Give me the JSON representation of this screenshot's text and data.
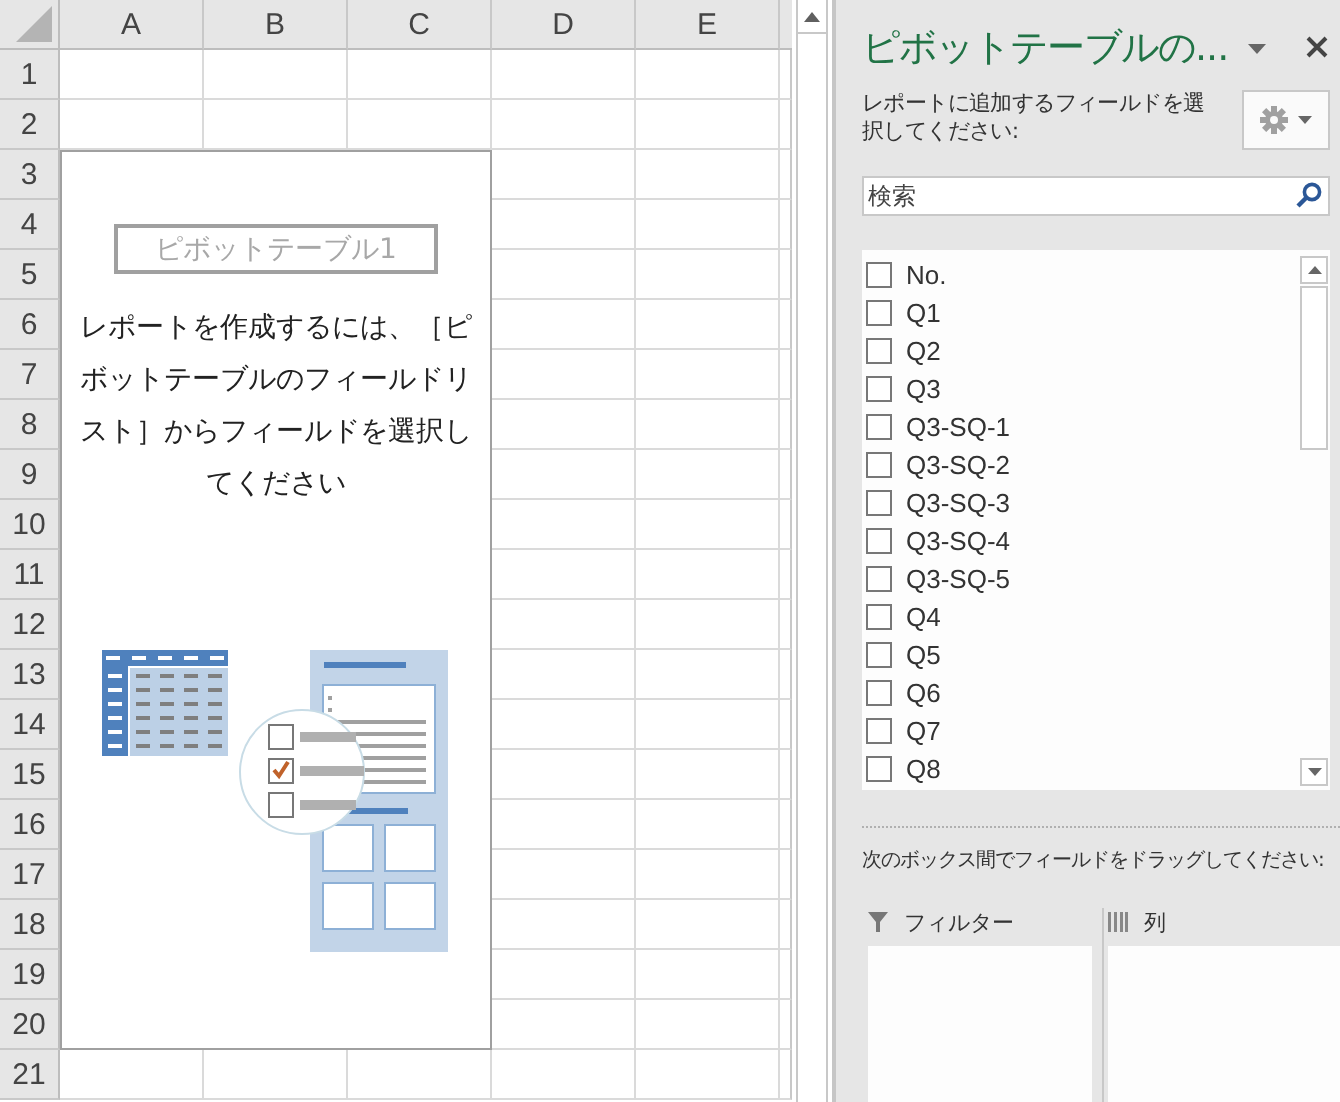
{
  "sheet": {
    "columns": [
      "A",
      "B",
      "C",
      "D",
      "E"
    ],
    "rows": [
      "1",
      "2",
      "3",
      "4",
      "5",
      "6",
      "7",
      "8",
      "9",
      "10",
      "11",
      "12",
      "13",
      "14",
      "15",
      "16",
      "17",
      "18",
      "19",
      "20",
      "21"
    ],
    "pivot_placeholder": {
      "name": "ピボットテーブル1",
      "message": "レポートを作成するには、［ピボットテーブルのフィールドリスト］からフィールドを選択してください"
    }
  },
  "pane": {
    "title": "ピボットテーブルの...",
    "instruction": "レポートに追加するフィールドを選択してください:",
    "search": {
      "placeholder": "検索"
    },
    "fields": [
      {
        "label": "No.",
        "checked": false
      },
      {
        "label": "Q1",
        "checked": false
      },
      {
        "label": "Q2",
        "checked": false
      },
      {
        "label": "Q3",
        "checked": false
      },
      {
        "label": "Q3-SQ-1",
        "checked": false
      },
      {
        "label": "Q3-SQ-2",
        "checked": false
      },
      {
        "label": "Q3-SQ-3",
        "checked": false
      },
      {
        "label": "Q3-SQ-4",
        "checked": false
      },
      {
        "label": "Q3-SQ-5",
        "checked": false
      },
      {
        "label": "Q4",
        "checked": false
      },
      {
        "label": "Q5",
        "checked": false
      },
      {
        "label": "Q6",
        "checked": false
      },
      {
        "label": "Q7",
        "checked": false
      },
      {
        "label": "Q8",
        "checked": false
      }
    ],
    "drag_hint": "次のボックス間でフィールドをドラッグしてください:",
    "areas": [
      {
        "label": "フィルター",
        "kind": "filter"
      },
      {
        "label": "列",
        "kind": "columns"
      }
    ]
  }
}
